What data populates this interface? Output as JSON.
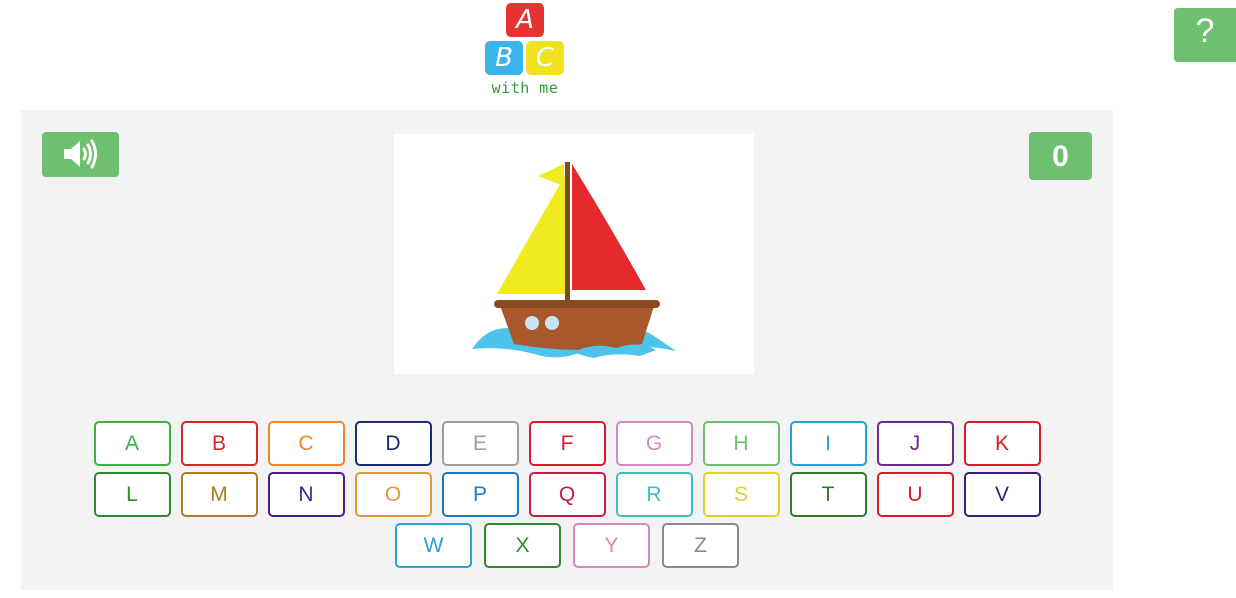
{
  "logo": {
    "letters": [
      "A",
      "B",
      "C"
    ],
    "tagline": "with me"
  },
  "help": {
    "label": "?"
  },
  "sound": {
    "icon": "speaker-icon"
  },
  "score": {
    "value": "0"
  },
  "picture": {
    "subject": "boat"
  },
  "keyboard": {
    "rows": [
      [
        {
          "letter": "A",
          "color": "#3cb043"
        },
        {
          "letter": "B",
          "color": "#d42a2a"
        },
        {
          "letter": "C",
          "color": "#f0862a"
        },
        {
          "letter": "D",
          "color": "#1c2a6e"
        },
        {
          "letter": "E",
          "color": "#9e9e9e"
        },
        {
          "letter": "F",
          "color": "#d41c2a"
        },
        {
          "letter": "G",
          "color": "#d488c0"
        },
        {
          "letter": "H",
          "color": "#6ebf70"
        },
        {
          "letter": "I",
          "color": "#2a9fd4"
        },
        {
          "letter": "J",
          "color": "#6e2a8a"
        },
        {
          "letter": "K",
          "color": "#d41c2a"
        }
      ],
      [
        {
          "letter": "L",
          "color": "#2e8b2e"
        },
        {
          "letter": "M",
          "color": "#b07a2a"
        },
        {
          "letter": "N",
          "color": "#4a1c8a"
        },
        {
          "letter": "O",
          "color": "#e09a3c"
        },
        {
          "letter": "P",
          "color": "#1c7ac0"
        },
        {
          "letter": "Q",
          "color": "#c41c4a"
        },
        {
          "letter": "R",
          "color": "#3cc0c0"
        },
        {
          "letter": "S",
          "color": "#e0d02a"
        },
        {
          "letter": "T",
          "color": "#2e7d2e"
        },
        {
          "letter": "U",
          "color": "#d41c2a"
        },
        {
          "letter": "V",
          "color": "#3a1c7a"
        }
      ],
      [
        {
          "letter": "W",
          "color": "#2a9fd4"
        },
        {
          "letter": "X",
          "color": "#2e8b2e"
        },
        {
          "letter": "Y",
          "color": "#d488c0"
        },
        {
          "letter": "Z",
          "color": "#8a8a8a"
        }
      ]
    ]
  }
}
